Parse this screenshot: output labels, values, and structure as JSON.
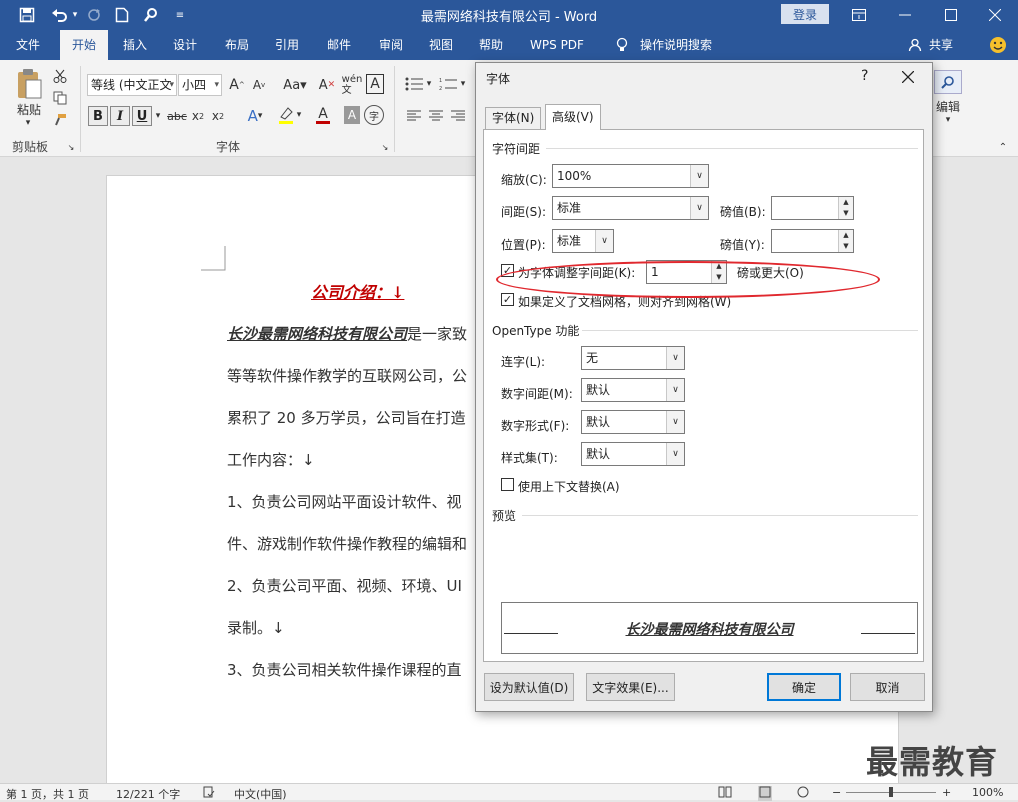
{
  "window": {
    "title": "最需网络科技有限公司 - Word",
    "login_label": "登录"
  },
  "tabs": [
    "文件",
    "开始",
    "插入",
    "设计",
    "布局",
    "引用",
    "邮件",
    "审阅",
    "视图",
    "帮助",
    "WPS PDF",
    "操作说明搜索",
    "共享"
  ],
  "ribbon": {
    "paste_label": "粘贴",
    "clipboard_label": "剪贴板",
    "font_name": "等线 (中文正文",
    "font_size": "小四",
    "font_group_label": "字体",
    "bold": "B",
    "italic": "I",
    "underline": "U",
    "editing_label": "编辑"
  },
  "document": {
    "heading": "公司介绍：↓",
    "lines": [
      {
        "bold": "长沙最需网络科技有限公司",
        "text": "是一家致"
      },
      {
        "bold": "",
        "text": "等等软件操作教学的互联网公司，公"
      },
      {
        "bold": "",
        "text": "累积了 20 多万学员，公司旨在打造"
      },
      {
        "bold": "",
        "text": "工作内容：↓"
      },
      {
        "bold": "",
        "text": "1、负责公司网站平面设计软件、视"
      },
      {
        "bold": "",
        "text": "件、游戏制作软件操作教程的编辑和"
      },
      {
        "bold": "",
        "text": "2、负责公司平面、视频、环境、UI"
      },
      {
        "bold": "",
        "text": "录制。↓"
      },
      {
        "bold": "",
        "text": "3、负责公司相关软件操作课程的直"
      }
    ],
    "watermark": "最需教育"
  },
  "status": {
    "page": "第 1 页，共 1 页",
    "words": "12/221 个字",
    "lang": "中文(中国)",
    "zoom": "100%"
  },
  "dialog": {
    "title": "字体",
    "help": "?",
    "tab_font": "字体(N)",
    "tab_advanced": "高级(V)",
    "section_spacing": "字符间距",
    "scale_label": "缩放(C):",
    "scale_value": "100%",
    "spacing_label": "间距(S):",
    "spacing_value": "标准",
    "by_label_1": "磅值(B):",
    "by_value_1": "",
    "position_label": "位置(P):",
    "position_value": "标准",
    "by_label_2": "磅值(Y):",
    "by_value_2": "",
    "kerning_label": "为字体调整字间距(K):",
    "kerning_checked": true,
    "kerning_value": "1",
    "kerning_suffix": "磅或更大(O)",
    "grid_label": "如果定义了文档网格，则对齐到网格(W)",
    "grid_checked": true,
    "section_opentype": "OpenType 功能",
    "ligatures_label": "连字(L):",
    "ligatures_value": "无",
    "numspacing_label": "数字间距(M):",
    "numspacing_value": "默认",
    "numforms_label": "数字形式(F):",
    "numforms_value": "默认",
    "stylistic_label": "样式集(T):",
    "stylistic_value": "默认",
    "contextual_label": "使用上下文替换(A)",
    "contextual_checked": false,
    "section_preview": "预览",
    "preview_text": "长沙最需网络科技有限公司",
    "btn_default": "设为默认值(D)",
    "btn_effects": "文字效果(E)...",
    "btn_ok": "确定",
    "btn_cancel": "取消"
  },
  "colors": {
    "title_bar": "#2b579a",
    "heading_red": "#c00000",
    "highlight_ellipse": "#e0282e"
  }
}
